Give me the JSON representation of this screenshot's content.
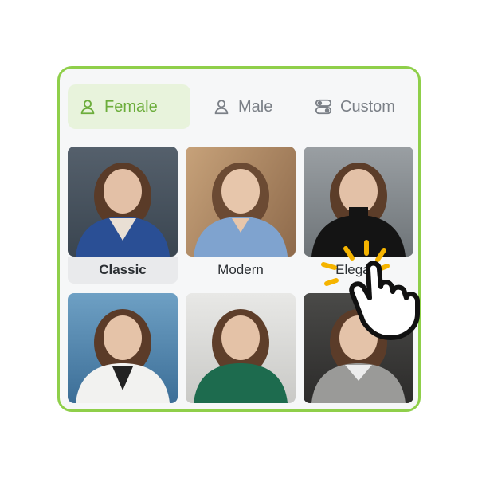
{
  "tabs": [
    {
      "label": "Female",
      "icon": "person-icon",
      "active": true
    },
    {
      "label": "Male",
      "icon": "person-icon",
      "active": false
    },
    {
      "label": "Custom",
      "icon": "toggle-icon",
      "active": false
    }
  ],
  "styles": [
    {
      "label": "Classic",
      "selected": true
    },
    {
      "label": "Modern",
      "selected": false
    },
    {
      "label": "Elegant",
      "selected": false
    },
    {
      "label": "",
      "selected": false
    },
    {
      "label": "",
      "selected": false
    },
    {
      "label": "",
      "selected": false
    }
  ],
  "colors": {
    "accent": "#8fcf4a",
    "accent_text": "#6cad3b",
    "cursor_highlight": "#f5b400"
  }
}
